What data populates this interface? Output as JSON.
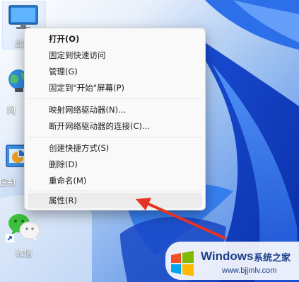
{
  "desktop": {
    "icons": [
      {
        "label": "此电",
        "icon": "monitor-icon"
      },
      {
        "label": "网",
        "icon": "network-icon"
      },
      {
        "label": "控制",
        "icon": "control-panel-icon"
      },
      {
        "label": "微信",
        "icon": "wechat-icon"
      }
    ]
  },
  "context_menu": {
    "items": [
      {
        "label": "打开(O)",
        "bold": true
      },
      {
        "label": "固定到快速访问"
      },
      {
        "label": "管理(G)"
      },
      {
        "label": "固定到\"开始\"屏幕(P)"
      },
      {
        "label": "映射网络驱动器(N)..."
      },
      {
        "label": "断开网络驱动器的连接(C)..."
      },
      {
        "label": "创建快捷方式(S)"
      },
      {
        "label": "删除(D)"
      },
      {
        "label": "重命名(M)"
      },
      {
        "label": "属性(R)",
        "highlighted": true
      }
    ]
  },
  "watermark": {
    "title": "Windows",
    "subtitle": "系统之家",
    "url": "www.bjjmlv.com"
  },
  "colors": {
    "arrow": "#e53222",
    "menu_bg": "#f9f9f9",
    "wallpaper": "#1f5fe0"
  }
}
